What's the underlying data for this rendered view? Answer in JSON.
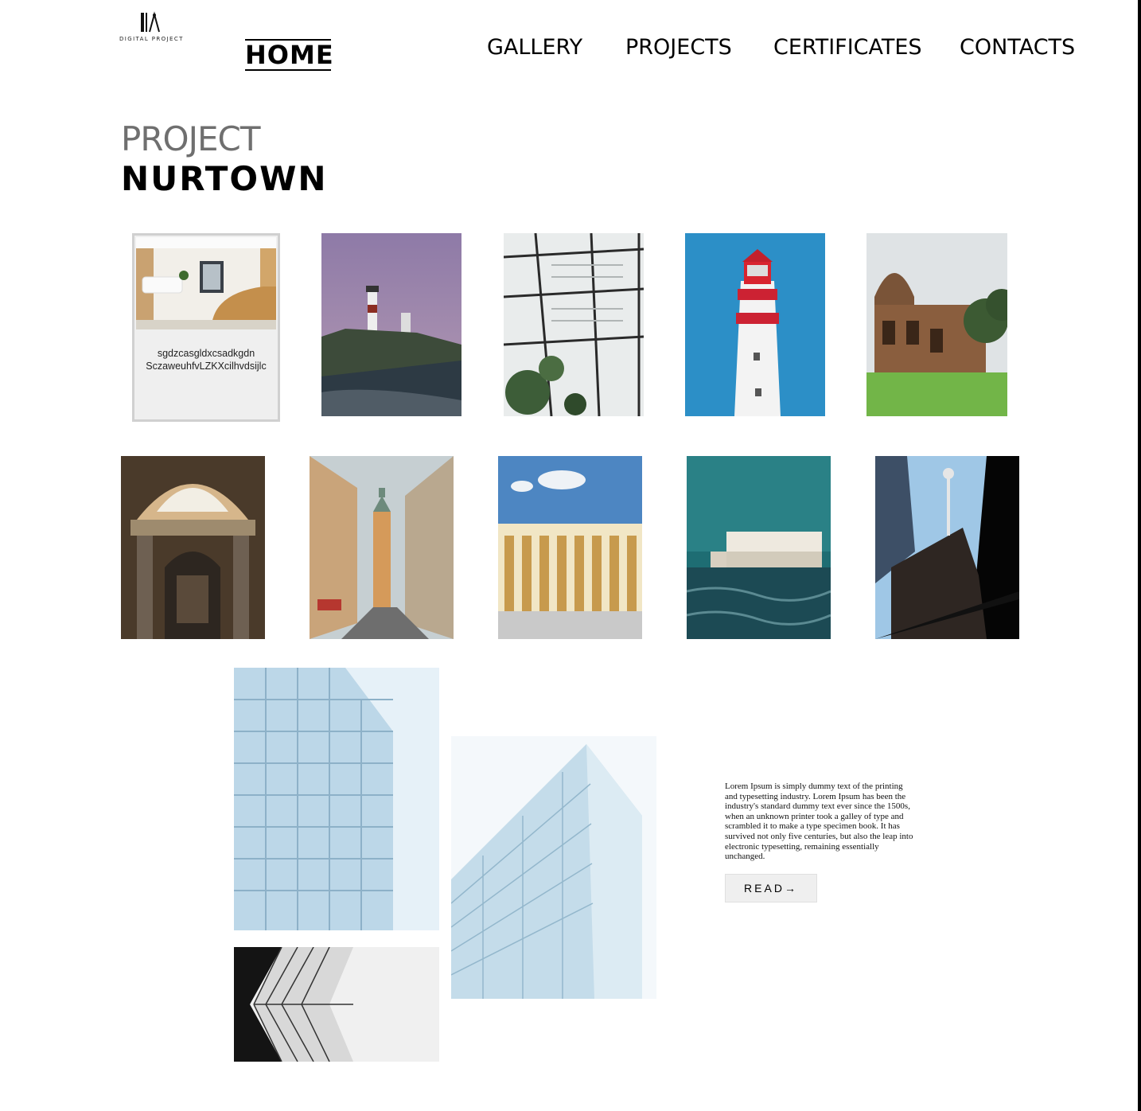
{
  "header": {
    "logo_text": "DIGITAL PROJECT",
    "nav": {
      "home": "HOME",
      "gallery": "GALLERY",
      "projects": "PROJECTS",
      "certificates": "CERTIFICATES",
      "contacts": "CONTACTS"
    }
  },
  "title": {
    "line1": "PROJECT",
    "line2": "NURTOWN"
  },
  "card": {
    "line1": "sgdzcasgldxcsadkgdn",
    "line2": "SczaweuhfvLZKXcilhvdsijlc"
  },
  "feature": {
    "text": "Lorem Ipsum is simply dummy text of the printing and typesetting industry. Lorem Ipsum has been the industry's standard dummy text ever since the 1500s, when an unknown printer took a galley of type and scrambled it to make a type specimen book. It has survived not only five centuries, but also the leap into electronic typesetting, remaining essentially unchanged.",
    "read_label": "READ→"
  },
  "colors": {
    "accent": "#000000",
    "muted_title": "#6f6f6f",
    "card_bg": "#efefef"
  }
}
